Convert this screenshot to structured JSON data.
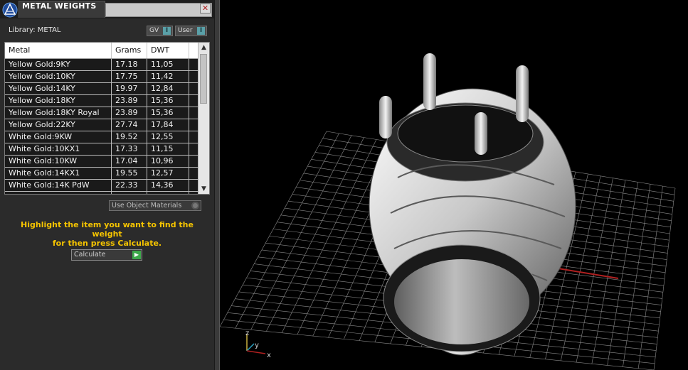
{
  "window": {
    "title": "METAL WEIGHTS",
    "close_symbol": "✕"
  },
  "library": {
    "label": "Library: METAL",
    "toggles": [
      {
        "label": "GV",
        "state": "I"
      },
      {
        "label": "User",
        "state": "I"
      }
    ]
  },
  "table": {
    "columns": [
      "Metal",
      "Grams",
      "DWT"
    ],
    "rows": [
      [
        "Yellow Gold:9KY",
        "17.18",
        "11,05"
      ],
      [
        "Yellow Gold:10KY",
        "17.75",
        "11,42"
      ],
      [
        "Yellow Gold:14KY",
        "19.97",
        "12,84"
      ],
      [
        "Yellow Gold:18KY",
        "23.89",
        "15,36"
      ],
      [
        "Yellow Gold:18KY Royal",
        "23.89",
        "15,36"
      ],
      [
        "Yellow Gold:22KY",
        "27.74",
        "17,84"
      ],
      [
        "White Gold:9KW",
        "19.52",
        "12,55"
      ],
      [
        "White Gold:10KX1",
        "17.33",
        "11,15"
      ],
      [
        "White Gold:10KW",
        "17.04",
        "10,96"
      ],
      [
        "White Gold:14KX1",
        "19.55",
        "12,57"
      ],
      [
        "White Gold:14K PdW",
        "22.33",
        "14,36"
      ]
    ],
    "scroll_up": "▲",
    "scroll_down": "▼"
  },
  "use_object_materials": {
    "label": "Use Object Materials"
  },
  "hint": {
    "line1": "Highlight the item you want to find the weight",
    "line2": "for then press Calculate."
  },
  "calculate": {
    "label": "Calculate",
    "go_symbol": "▶"
  },
  "viewport": {
    "axis_labels": {
      "z": "z",
      "y": "y",
      "x": "x"
    },
    "colors": {
      "grid": "#8a8a8a",
      "x_axis": "#b02020",
      "y_axis": "#2aa0c0",
      "z_axis": "#c8b040",
      "ring": "#d0d0d0"
    }
  }
}
